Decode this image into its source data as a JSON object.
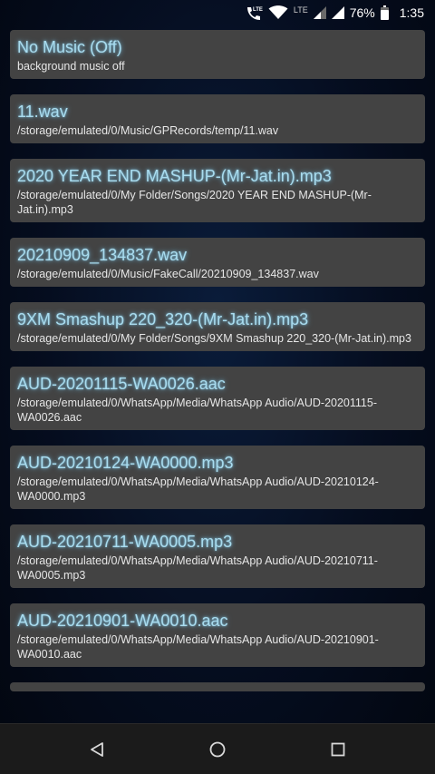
{
  "status_bar": {
    "network_label": "LTE",
    "battery": "76%",
    "time": "1:35",
    "icons": [
      "wifi-calling-icon",
      "wifi-icon",
      "signal-icon",
      "signal-icon",
      "battery-icon"
    ]
  },
  "music_list": [
    {
      "title": "No Music (Off)",
      "path": "background music off"
    },
    {
      "title": "11.wav",
      "path": "/storage/emulated/0/Music/GPRecords/temp/11.wav"
    },
    {
      "title": "2020 YEAR END MASHUP-(Mr-Jat.in).mp3",
      "path": "/storage/emulated/0/My Folder/Songs/2020 YEAR END MASHUP-(Mr-Jat.in).mp3"
    },
    {
      "title": "20210909_134837.wav",
      "path": "/storage/emulated/0/Music/FakeCall/20210909_134837.wav"
    },
    {
      "title": "9XM Smashup 220_320-(Mr-Jat.in).mp3",
      "path": "/storage/emulated/0/My Folder/Songs/9XM Smashup 220_320-(Mr-Jat.in).mp3"
    },
    {
      "title": "AUD-20201115-WA0026.aac",
      "path": "/storage/emulated/0/WhatsApp/Media/WhatsApp Audio/AUD-20201115-WA0026.aac"
    },
    {
      "title": "AUD-20210124-WA0000.mp3",
      "path": "/storage/emulated/0/WhatsApp/Media/WhatsApp Audio/AUD-20210124-WA0000.mp3"
    },
    {
      "title": "AUD-20210711-WA0005.mp3",
      "path": "/storage/emulated/0/WhatsApp/Media/WhatsApp Audio/AUD-20210711-WA0005.mp3"
    },
    {
      "title": "AUD-20210901-WA0010.aac",
      "path": "/storage/emulated/0/WhatsApp/Media/WhatsApp Audio/AUD-20210901-WA0010.aac"
    }
  ],
  "nav_bar": {
    "buttons": [
      "back-icon",
      "home-icon",
      "recents-icon"
    ]
  }
}
